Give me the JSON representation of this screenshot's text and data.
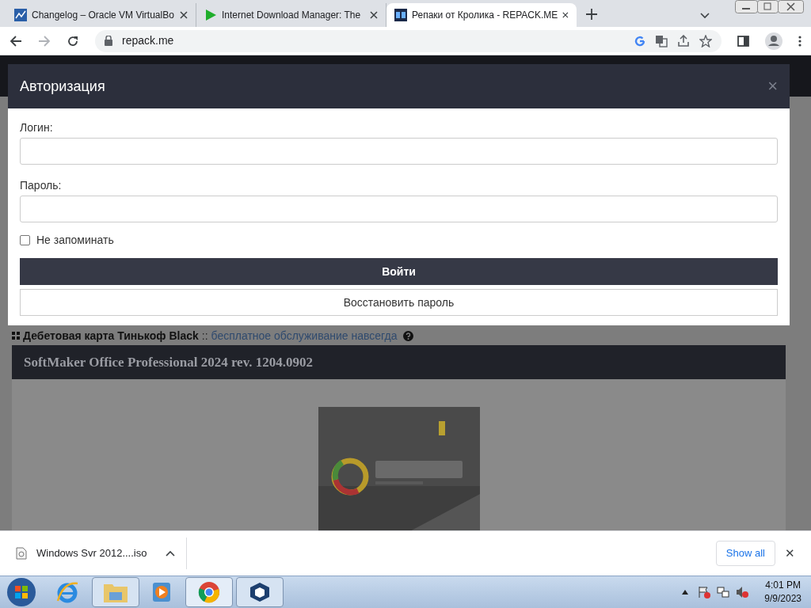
{
  "browser": {
    "tabs": [
      {
        "title": "Changelog – Oracle VM VirtualBo",
        "selected": false
      },
      {
        "title": "Internet Download Manager: The",
        "selected": false
      },
      {
        "title": "Репаки от Кролика - REPACK.ME",
        "selected": true
      }
    ],
    "address": "repack.me"
  },
  "page": {
    "promo_title": "Дебетовая карта Тинькоф Black",
    "promo_separator": "::",
    "promo_link": "бесплатное обслуживание навсегда",
    "post_title": "SoftMaker Office Professional 2024 rev. 1204.0902"
  },
  "modal": {
    "title": "Авторизация",
    "close": "×",
    "fields": [
      {
        "label": "Логин:"
      },
      {
        "label": "Пароль:"
      }
    ],
    "remember": {
      "label": "Не запоминать",
      "checked": false
    },
    "submit": "Войти",
    "restore": "Восстановить пароль"
  },
  "downloads": {
    "file": "Windows Svr 2012....iso",
    "show_all": "Show all",
    "close": "✕"
  },
  "taskbar": {
    "time": "4:01 PM",
    "date": "9/9/2023"
  }
}
